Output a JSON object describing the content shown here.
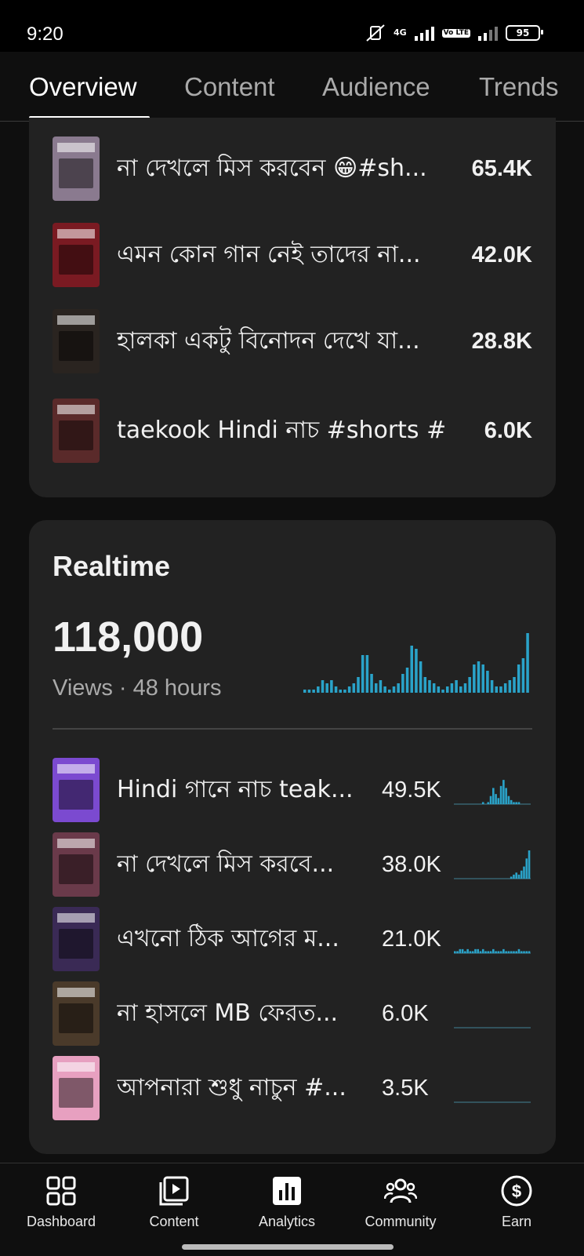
{
  "status_bar": {
    "time": "9:20",
    "network": "4G",
    "volte": "Vo LTE",
    "battery": "95"
  },
  "tabs": [
    {
      "label": "Overview",
      "active": true
    },
    {
      "label": "Content",
      "active": false
    },
    {
      "label": "Audience",
      "active": false
    },
    {
      "label": "Trends",
      "active": false
    }
  ],
  "top_content": [
    {
      "title": "না দেখলে মিস করবেন 😁#sh...",
      "value": "65.4K",
      "thumb_color": "#8a7a8f"
    },
    {
      "title": "এমন কোন গান নেই তাদের না...",
      "value": "42.0K",
      "thumb_color": "#7a1a22"
    },
    {
      "title": "হালকা একটু বিনোদন দেখে যা...",
      "value": "28.8K",
      "thumb_color": "#2a2420"
    },
    {
      "title": "taekook Hindi নাচ #shorts #...",
      "value": "6.0K",
      "thumb_color": "#5a2a2a"
    }
  ],
  "realtime": {
    "title": "Realtime",
    "count": "118,000",
    "label": "Views · 48 hours",
    "spark_color": "#2aa3c9",
    "bars": [
      1,
      1,
      1,
      2,
      4,
      3,
      4,
      2,
      1,
      1,
      2,
      3,
      5,
      12,
      12,
      6,
      3,
      4,
      2,
      1,
      2,
      3,
      6,
      8,
      15,
      14,
      10,
      5,
      4,
      3,
      2,
      1,
      2,
      3,
      4,
      2,
      3,
      5,
      9,
      10,
      9,
      7,
      4,
      2,
      2,
      3,
      4,
      5,
      9,
      11,
      19
    ]
  },
  "realtime_items": [
    {
      "title": "Hindi গানে নাচ teak...",
      "value": "49.5K",
      "thumb_color": "#7b4ad0",
      "spark": [
        0,
        0,
        0,
        0,
        0,
        0,
        0,
        0,
        0,
        0,
        0,
        1,
        0,
        1,
        4,
        8,
        5,
        3,
        9,
        12,
        8,
        4,
        2,
        1,
        1,
        1,
        0,
        0,
        0,
        0
      ]
    },
    {
      "title": "না দেখলে মিস করবে...",
      "value": "38.0K",
      "thumb_color": "#6a3a4a",
      "spark": [
        0,
        0,
        0,
        0,
        0,
        0,
        0,
        0,
        0,
        0,
        0,
        0,
        0,
        0,
        0,
        0,
        0,
        0,
        0,
        0,
        0,
        0,
        1,
        2,
        3,
        2,
        4,
        6,
        10,
        14
      ]
    },
    {
      "title": "এখনো ঠিক আগের ম...",
      "value": "21.0K",
      "thumb_color": "#3a2a55",
      "spark": [
        1,
        1,
        2,
        2,
        1,
        2,
        1,
        1,
        2,
        2,
        1,
        2,
        1,
        1,
        1,
        2,
        1,
        1,
        1,
        2,
        1,
        1,
        1,
        1,
        1,
        2,
        1,
        1,
        1,
        1
      ]
    },
    {
      "title": "না হাসলে MB ফেরত...",
      "value": "6.0K",
      "thumb_color": "#4a3a2a",
      "spark": [
        0,
        0,
        0,
        0,
        0,
        0,
        0,
        0,
        0,
        0,
        0,
        0,
        0,
        0,
        0,
        0,
        0,
        0,
        0,
        0,
        0,
        0,
        0,
        0,
        0,
        0,
        0,
        0,
        0,
        0
      ]
    },
    {
      "title": "আপনারা শুধু নাচুন #...",
      "value": "3.5K",
      "thumb_color": "#e7a0c0",
      "spark": [
        0,
        0,
        0,
        0,
        0,
        0,
        0,
        0,
        0,
        0,
        0,
        0,
        0,
        0,
        0,
        0,
        0,
        0,
        0,
        0,
        0,
        0,
        0,
        0,
        0,
        0,
        0,
        0,
        0,
        0
      ]
    }
  ],
  "bottom_nav": [
    {
      "label": "Dashboard",
      "icon": "dashboard-icon"
    },
    {
      "label": "Content",
      "icon": "content-icon"
    },
    {
      "label": "Analytics",
      "icon": "analytics-icon"
    },
    {
      "label": "Community",
      "icon": "community-icon"
    },
    {
      "label": "Earn",
      "icon": "earn-icon"
    }
  ]
}
